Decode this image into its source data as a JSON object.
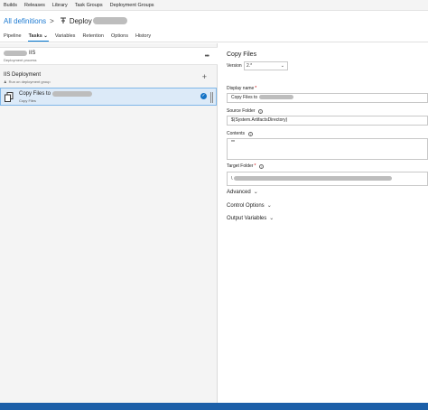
{
  "topnav": {
    "items": [
      "Builds",
      "Releases",
      "Library",
      "Task Groups",
      "Deployment Groups"
    ]
  },
  "breadcrumb": {
    "all_definitions": "All definitions",
    "separator": ">",
    "pipeline_name": "Deploy"
  },
  "tabs": [
    {
      "label": "Pipeline",
      "active": false
    },
    {
      "label": "Tasks",
      "active": true
    },
    {
      "label": "Variables",
      "active": false
    },
    {
      "label": "Retention",
      "active": false
    },
    {
      "label": "Options",
      "active": false
    },
    {
      "label": "History",
      "active": false
    }
  ],
  "left": {
    "process_title_suffix": "IIS",
    "process_subtitle": "Deployment process",
    "more_icon": "ellipsis-icon",
    "phase_title": "IIS Deployment",
    "phase_subtitle": "Run on deployment group",
    "add_icon": "plus-icon",
    "task_title": "Copy Files to",
    "task_subtitle": "Copy Files"
  },
  "right": {
    "title": "Copy Files",
    "version_label": "Version",
    "version_value": "2.*",
    "display_name_label": "Display name",
    "display_name_value": "Copy Files to",
    "source_folder_label": "Source Folder",
    "source_folder_value": "$(System.ArtifactsDirectory)",
    "contents_label": "Contents",
    "contents_value": "**",
    "target_folder_label": "Target Folder",
    "target_folder_value": "\\",
    "sections": [
      "Advanced",
      "Control Options",
      "Output Variables"
    ]
  },
  "colors": {
    "accent": "#0078d4",
    "link": "#1e7bd2",
    "selected_bg": "#dceaf8",
    "statusbar": "#1c5fa8"
  }
}
